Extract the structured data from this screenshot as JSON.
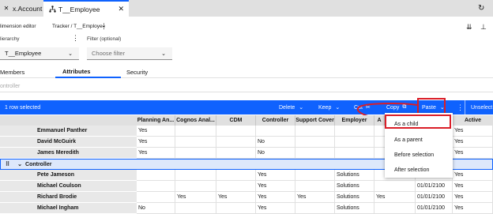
{
  "tabs": [
    {
      "label": "x.Account"
    },
    {
      "label": "T__Employee"
    }
  ],
  "editor": {
    "title": "limension editor",
    "breadcrumb": "Tracker / T__Employee",
    "hierarchy_label": "lierarchy",
    "hierarchy_value": "T__Employee",
    "filter_label": "Filter (optional)",
    "filter_placeholder": "Choose filter"
  },
  "subtabs": [
    "Members",
    "Attributes",
    "Security"
  ],
  "selected_subtab": "Attributes",
  "search_text": "ontroller",
  "toolbar": {
    "selection": "1 row selected",
    "delete": "Delete",
    "keep": "Keep",
    "cut": "Cut",
    "copy": "Copy",
    "paste": "Paste",
    "unselect": "Unselect"
  },
  "columns": [
    "Planning An...",
    "Cognos Anal...",
    "CDM",
    "Controller",
    "Support Cover",
    "Employer",
    "A",
    "",
    "Active"
  ],
  "rows": [
    {
      "name": "Emmanuel Panther",
      "cells": [
        "Yes",
        "",
        "",
        "",
        "",
        "",
        "",
        "",
        "Yes"
      ]
    },
    {
      "name": "David McGuirk",
      "cells": [
        "Yes",
        "",
        "",
        "No",
        "",
        "",
        "",
        "",
        "Yes"
      ]
    },
    {
      "name": "James Meredith",
      "cells": [
        "Yes",
        "",
        "",
        "No",
        "",
        "",
        "",
        "",
        "Yes"
      ]
    },
    {
      "name": "Controller",
      "cells": [
        "",
        "",
        "",
        "",
        "",
        "",
        "",
        "",
        ""
      ]
    },
    {
      "name": "Pete Jameson",
      "cells": [
        "",
        "",
        "",
        "Yes",
        "",
        "Solutions",
        "",
        "",
        "Yes"
      ]
    },
    {
      "name": "Michael Coulson",
      "cells": [
        "",
        "",
        "",
        "Yes",
        "",
        "Solutions",
        "",
        "01/01/2100",
        "Yes"
      ]
    },
    {
      "name": "Richard Brodie",
      "cells": [
        "",
        "Yes",
        "Yes",
        "Yes",
        "Yes",
        "Solutions",
        "Yes",
        "01/01/2100",
        "Yes"
      ]
    },
    {
      "name": "Michael Ingham",
      "cells": [
        "No",
        "",
        "",
        "Yes",
        "",
        "Solutions",
        "",
        "01/01/2100",
        "Yes"
      ]
    }
  ],
  "paste_menu": [
    "As a child",
    "As a parent",
    "Before selection",
    "After selection"
  ],
  "colors": {
    "accent": "#0f62fe",
    "highlight": "#da1e28",
    "selected_row": "#dde8fb"
  }
}
